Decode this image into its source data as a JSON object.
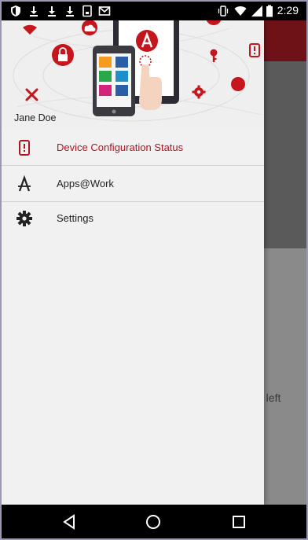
{
  "status_bar": {
    "time": "2:29",
    "icons": [
      "shield-icon",
      "download-icon",
      "download-icon",
      "download-icon",
      "sim-icon",
      "gmail-icon",
      "vibrate-icon",
      "wifi-icon",
      "signal-icon",
      "battery-icon"
    ]
  },
  "drawer": {
    "user_name": "Jane Doe",
    "items": [
      {
        "label": "Device Configuration Status",
        "icon": "device-alert-icon",
        "active": true
      },
      {
        "label": "Apps@Work",
        "icon": "apps-at-work-icon",
        "active": false
      },
      {
        "label": "Settings",
        "icon": "gear-icon",
        "active": false
      }
    ]
  },
  "background_screen": {
    "partial_text": "r\no left"
  },
  "navigation": {
    "icons": [
      "back-icon",
      "home-icon",
      "recents-icon"
    ]
  },
  "colors": {
    "brand_red": "#b3121f",
    "drawer_bg": "#f1f1f1",
    "toolbar": "#6e1218"
  }
}
